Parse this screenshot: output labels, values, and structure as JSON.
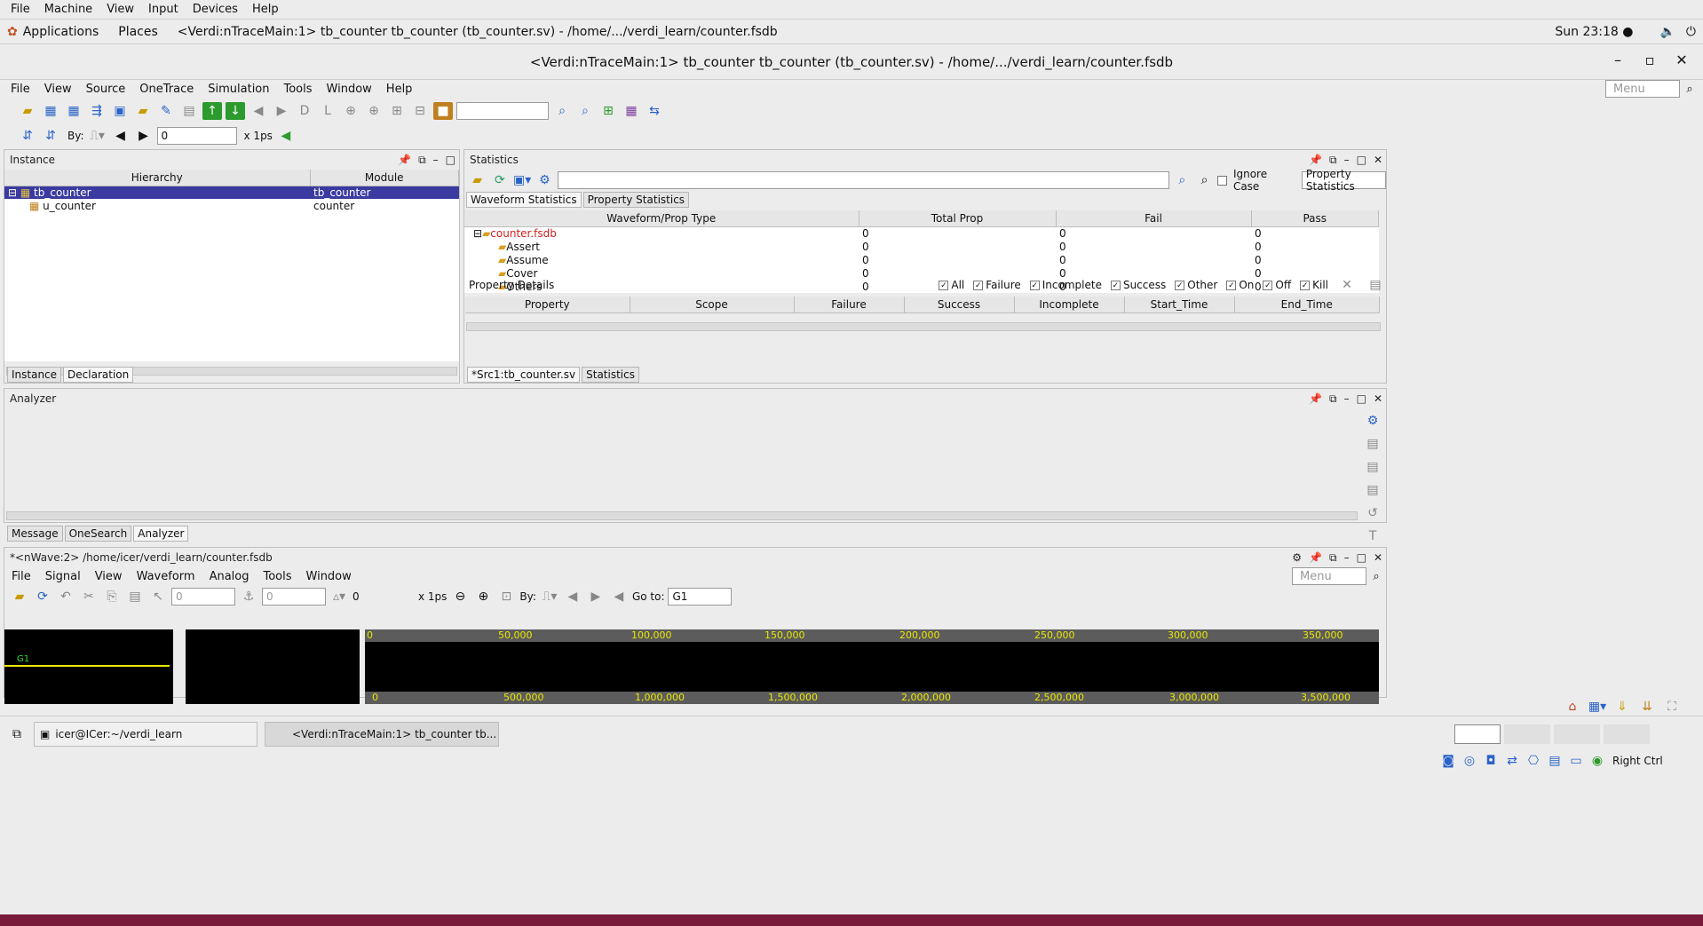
{
  "vbox_menu": [
    "File",
    "Machine",
    "View",
    "Input",
    "Devices",
    "Help"
  ],
  "gnome": {
    "applications": "Applications",
    "places": "Places",
    "window_title": "<Verdi:nTraceMain:1> tb_counter tb_counter (tb_counter.sv) - /home/.../verdi_learn/counter.fsdb",
    "clock": "Sun 23:18 ●"
  },
  "window": {
    "title": "<Verdi:nTraceMain:1> tb_counter tb_counter (tb_counter.sv) - /home/.../verdi_learn/counter.fsdb"
  },
  "main_menu": [
    "File",
    "View",
    "Source",
    "OneTrace",
    "Simulation",
    "Tools",
    "Window",
    "Help"
  ],
  "menu_search_placeholder": "Menu",
  "toolbar2": {
    "by_label": "By:",
    "time_value": "0",
    "unit": "x 1ps"
  },
  "instance_panel": {
    "title": "Instance",
    "col_hierarchy": "Hierarchy",
    "col_module": "Module",
    "rows": [
      {
        "name": "tb_counter",
        "module": "tb_counter"
      },
      {
        "name": "u_counter",
        "module": "counter"
      }
    ],
    "tabs": [
      "Instance",
      "Declaration"
    ]
  },
  "stats_panel": {
    "title": "Statistics",
    "ignore_case": "Ignore Case",
    "dropdown": "Property Statistics",
    "tabs": [
      "Waveform Statistics",
      "Property Statistics"
    ],
    "headers": [
      "Waveform/Prop Type",
      "Total Prop",
      "Fail",
      "Pass"
    ],
    "root": "counter.fsdb",
    "root_vals": [
      "0",
      "0",
      "0"
    ],
    "rows": [
      {
        "name": "Assert",
        "vals": [
          "0",
          "0",
          "0"
        ]
      },
      {
        "name": "Assume",
        "vals": [
          "0",
          "0",
          "0"
        ]
      },
      {
        "name": "Cover",
        "vals": [
          "0",
          "0",
          "0"
        ]
      },
      {
        "name": "Others",
        "vals": [
          "0",
          "0",
          "0"
        ]
      }
    ],
    "details_title": "Property Details",
    "filters": [
      "All",
      "Failure",
      "Incomplete",
      "Success",
      "Other",
      "On",
      "Off",
      "Kill"
    ],
    "detail_headers": [
      "Property",
      "Scope",
      "Failure",
      "Success",
      "Incomplete",
      "Start_Time",
      "End_Time"
    ],
    "bottom_tabs": [
      "*Src1:tb_counter.sv",
      "Statistics"
    ]
  },
  "analyzer": {
    "title": "Analyzer",
    "tabs": [
      "Message",
      "OneSearch",
      "Analyzer"
    ]
  },
  "nwave": {
    "title": "*<nWave:2> /home/icer/verdi_learn/counter.fsdb",
    "menu": [
      "File",
      "Signal",
      "View",
      "Waveform",
      "Analog",
      "Tools",
      "Window"
    ],
    "field1": "0",
    "field2": "0",
    "value": "0",
    "unit": "x 1ps",
    "by_label": "By:",
    "goto_label": "Go to:",
    "goto_value": "G1",
    "group_label": "G1",
    "top_ruler": [
      "0",
      "50,000",
      "100,000",
      "150,000",
      "200,000",
      "250,000",
      "300,000",
      "350,000"
    ],
    "bottom_ruler": [
      "0",
      "500,000",
      "1,000,000",
      "1,500,000",
      "2,000,000",
      "2,500,000",
      "3,000,000",
      "3,500,000"
    ]
  },
  "taskbar": {
    "terminal": "icer@ICer:~/verdi_learn",
    "verdi": "<Verdi:nTraceMain:1> tb_counter tb...",
    "right_ctrl": "Right Ctrl"
  }
}
